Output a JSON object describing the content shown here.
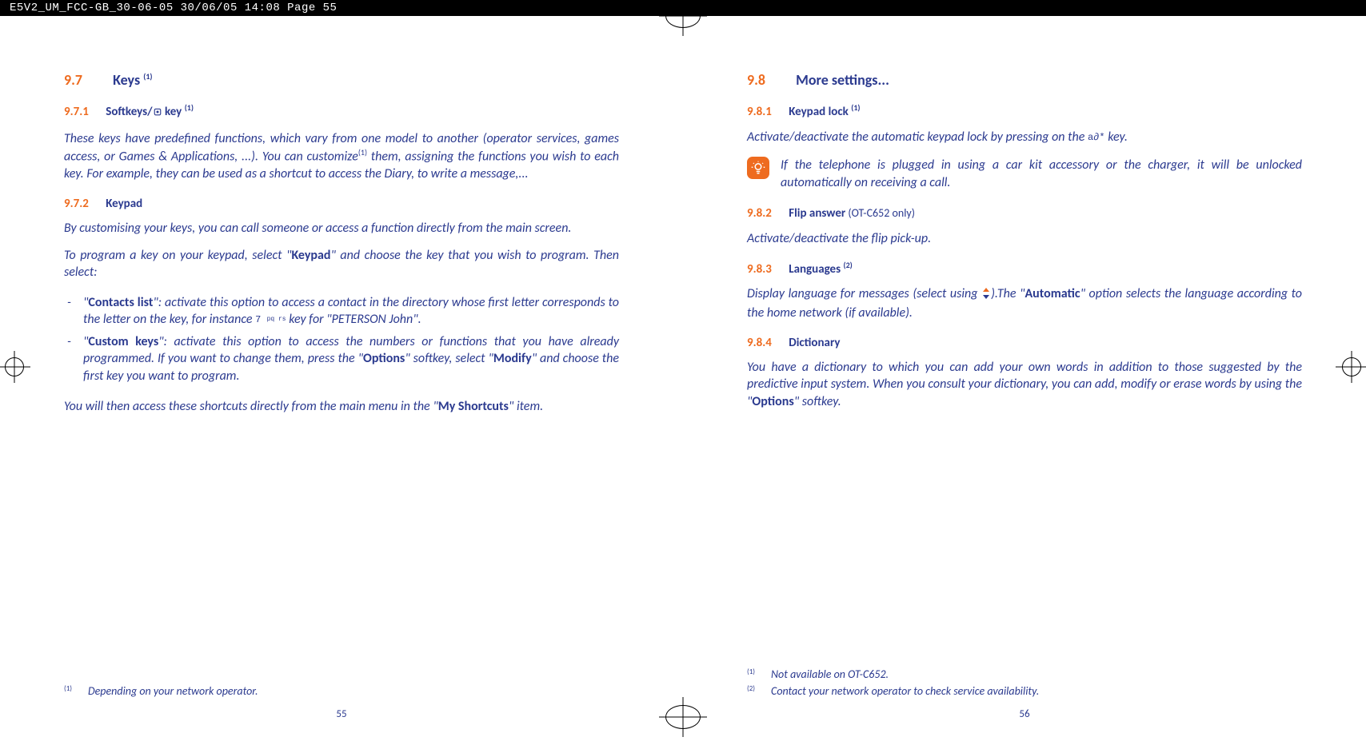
{
  "header": "E5V2_UM_FCC-GB_30-06-05  30/06/05  14:08  Page 55",
  "left": {
    "s97_num": "9.7",
    "s97_title": "Keys",
    "s97_sup": "(1)",
    "s971_num": "9.7.1",
    "s971_title": "Softkeys/",
    "s971_title2": " key",
    "s971_sup": "(1)",
    "p1_a": "These keys have predefined functions, which vary from one model to another (operator services, games access, or Games & Applications, ...). You can customize",
    "p1_sup": "(1)",
    "p1_b": " them, assigning the functions you wish to each key. For example, they can be used as a shortcut to access the Diary, to write a message,...",
    "s972_num": "9.7.2",
    "s972_title": "Keypad",
    "p2": "By customising your keys, you can call someone or access a function directly from the main screen.",
    "p3_a": "To program a key on your keypad, select \"",
    "p3_b": "Keypad",
    "p3_c": "\" and choose the key that you wish to program. Then select:",
    "li1_a": "\"",
    "li1_b": "Contacts list",
    "li1_c": "\": activate this option to access a contact in the directory whose first letter corresponds to the letter on the key, for instance ",
    "li1_key": "7",
    "li1_keysym": "pq rs",
    "li1_d": " key for \"PETERSON John\".",
    "li2_a": "\"",
    "li2_b": "Custom keys",
    "li2_c": "\": activate this option to access the numbers or functions that you have already programmed. If you want to change them, press the \"",
    "li2_d": "Options",
    "li2_e": "\" softkey, select \"",
    "li2_f": "Modify",
    "li2_g": "\" and choose the first key you want to program.",
    "p4_a": "You will then access these shortcuts directly from the main menu in the \"",
    "p4_b": "My Shortcuts",
    "p4_c": "\" item.",
    "fn1_mark": "(1)",
    "fn1_text": "Depending on your network operator.",
    "pagenum": "55"
  },
  "right": {
    "s98_num": "9.8",
    "s98_title": "More settings...",
    "s981_num": "9.8.1",
    "s981_title": "Keypad lock",
    "s981_sup": "(1)",
    "p1_a": "Activate/deactivate the automatic keypad lock by pressing on the ",
    "p1_key": "a∂*",
    "p1_b": " key.",
    "note": "If the telephone is plugged in using a car kit accessory or the charger, it will be unlocked automatically on receiving a call.",
    "s982_num": "9.8.2",
    "s982_title": "Flip answer",
    "s982_note": " (OT-C652 only)",
    "p2": "Activate/deactivate the flip pick-up.",
    "s983_num": "9.8.3",
    "s983_title": "Languages",
    "s983_sup": "(2)",
    "p3_a": "Display language for messages (select using ",
    "p3_b": ").The \"",
    "p3_c": "Automatic",
    "p3_d": "\" option selects the language according to the home network (if available).",
    "s984_num": "9.8.4",
    "s984_title": "Dictionary",
    "p4_a": "You have a dictionary to which you can add your own words in addition to those suggested by the predictive input system. When you consult your dictionary, you can add, modify or erase words by using the \"",
    "p4_b": "Options",
    "p4_c": "\" softkey.",
    "fn1_mark": "(1)",
    "fn1_text": "Not available on OT-C652.",
    "fn2_mark": "(2)",
    "fn2_text": "Contact your network operator to check service availability.",
    "pagenum": "56"
  }
}
